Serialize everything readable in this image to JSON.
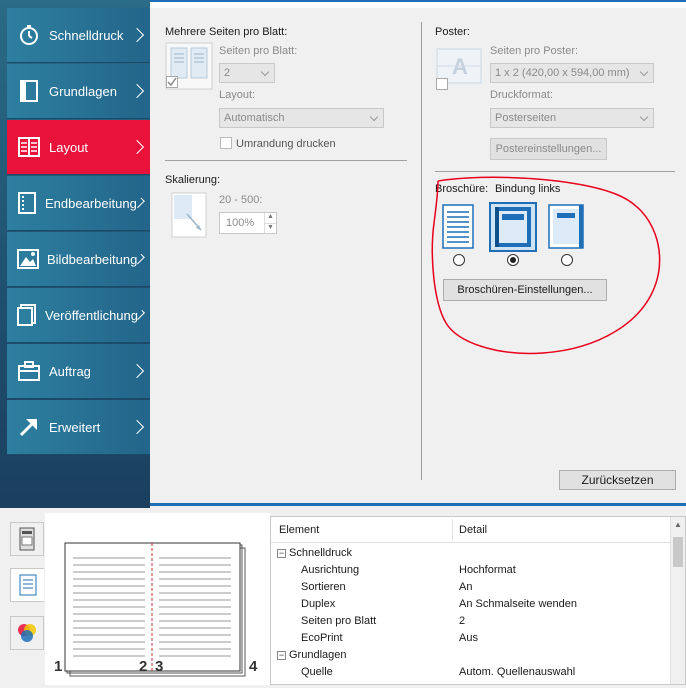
{
  "sidebar": {
    "items": [
      {
        "label": "Schnelldruck",
        "icon": "stopwatch-icon"
      },
      {
        "label": "Grundlagen",
        "icon": "page-icon"
      },
      {
        "label": "Layout",
        "icon": "layout-icon"
      },
      {
        "label": "Endbearbeitung",
        "icon": "finishing-icon"
      },
      {
        "label": "Bildbearbeitung",
        "icon": "image-icon"
      },
      {
        "label": "Veröffentlichung",
        "icon": "publishing-icon"
      },
      {
        "label": "Auftrag",
        "icon": "job-icon"
      },
      {
        "label": "Erweitert",
        "icon": "arrow-icon"
      }
    ],
    "active": "Layout",
    "active_color": "#e8123a",
    "bg_color": "#1f4f6f"
  },
  "layout": {
    "mehrere_title": "Mehrere Seiten pro Blatt:",
    "seiten_pro_blatt_label": "Seiten pro Blatt:",
    "seiten_pro_blatt_value": "2",
    "layout_label": "Layout:",
    "layout_value": "Automatisch",
    "umrandung_label": "Umrandung drucken",
    "skalierung_label": "Skalierung:",
    "skalierung_range": "20 - 500:",
    "skalierung_value": "100%",
    "poster_title": "Poster:",
    "seiten_pro_poster_label": "Seiten pro Poster:",
    "seiten_pro_poster_value": "1 x 2 (420,00 x 594,00 mm)",
    "druckformat_label": "Druckformat:",
    "druckformat_value": "Posterseiten",
    "postereinstellungen_button": "Postereinstellungen...",
    "broschure_label": "Broschüre:",
    "bindung_label": "Bindung links",
    "broschuren_button": "Broschüren-Einstellungen...",
    "zuruck_button": "Zurücksetzen",
    "brochure_selected": 1
  },
  "preview": {
    "page_labels": [
      "1",
      "2",
      "3",
      "4"
    ]
  },
  "tabs": [
    "printer-icon",
    "document-icon",
    "color-icon"
  ],
  "table": {
    "col1": "Element",
    "col2": "Detail",
    "rows": [
      {
        "group": true,
        "element": "Schnelldruck",
        "detail": ""
      },
      {
        "group": false,
        "element": "Ausrichtung",
        "detail": "Hochformat"
      },
      {
        "group": false,
        "element": "Sortieren",
        "detail": "An"
      },
      {
        "group": false,
        "element": "Duplex",
        "detail": "An Schmalseite wenden"
      },
      {
        "group": false,
        "element": "Seiten pro Blatt",
        "detail": "2"
      },
      {
        "group": false,
        "element": "EcoPrint",
        "detail": "Aus"
      },
      {
        "group": true,
        "element": "Grundlagen",
        "detail": ""
      },
      {
        "group": false,
        "element": "Quelle",
        "detail": "Autom. Quellenauswahl"
      }
    ]
  },
  "annotation_color": "#e8001c"
}
